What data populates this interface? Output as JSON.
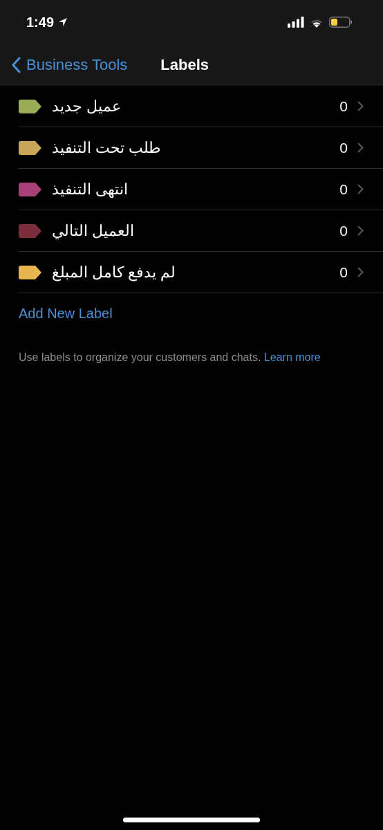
{
  "status_bar": {
    "time": "1:49"
  },
  "nav": {
    "back": "Business Tools",
    "title": "Labels"
  },
  "labels": [
    {
      "name": "عميل جديد",
      "count": "0",
      "color": "#9aac55"
    },
    {
      "name": "طلب تحت التنفيذ",
      "count": "0",
      "color": "#c8a75a"
    },
    {
      "name": "انتهى التنفيذ",
      "count": "0",
      "color": "#a8407a"
    },
    {
      "name": "العميل التالي",
      "count": "0",
      "color": "#7a2d3c"
    },
    {
      "name": "لم يدفع كامل المبلغ",
      "count": "0",
      "color": "#e8b64e"
    }
  ],
  "add_button": "Add New Label",
  "footer": {
    "text": "Use labels to organize your customers and chats.",
    "link": "Learn more"
  }
}
